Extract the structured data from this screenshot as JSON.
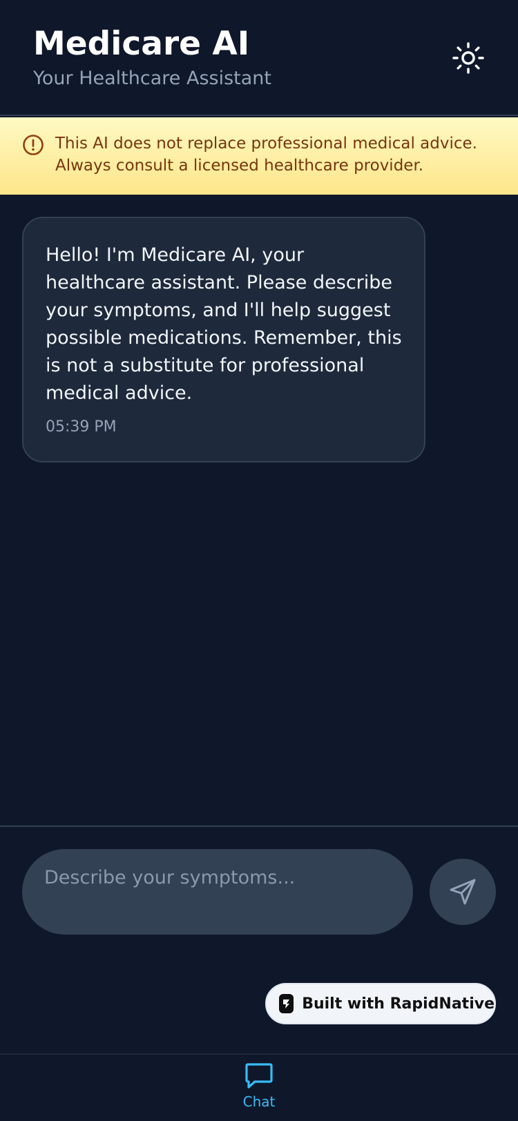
{
  "header": {
    "title": "Medicare AI",
    "subtitle": "Your Healthcare Assistant",
    "theme_icon": "sun-icon"
  },
  "disclaimer": {
    "icon": "alert-circle-icon",
    "line1": "This AI does not replace professional medical advice.",
    "line2": "Always consult a licensed healthcare provider."
  },
  "messages": [
    {
      "sender": "assistant",
      "text": "Hello! I'm Medicare AI, your healthcare assistant. Please describe your symptoms, and I'll help suggest possible medications. Remember, this is not a substitute for professional medical advice.",
      "time": "05:39 PM"
    }
  ],
  "composer": {
    "placeholder": "Describe your symptoms...",
    "value": "",
    "send_icon": "send-icon"
  },
  "badge": {
    "label": "Built with RapidNative"
  },
  "tabs": [
    {
      "label": "Chat",
      "icon": "chat-bubble-icon",
      "active": true
    }
  ],
  "colors": {
    "background": "#0f172a",
    "bubble": "#1e293b",
    "banner": "#fde68a",
    "accent": "#38bdf8"
  }
}
